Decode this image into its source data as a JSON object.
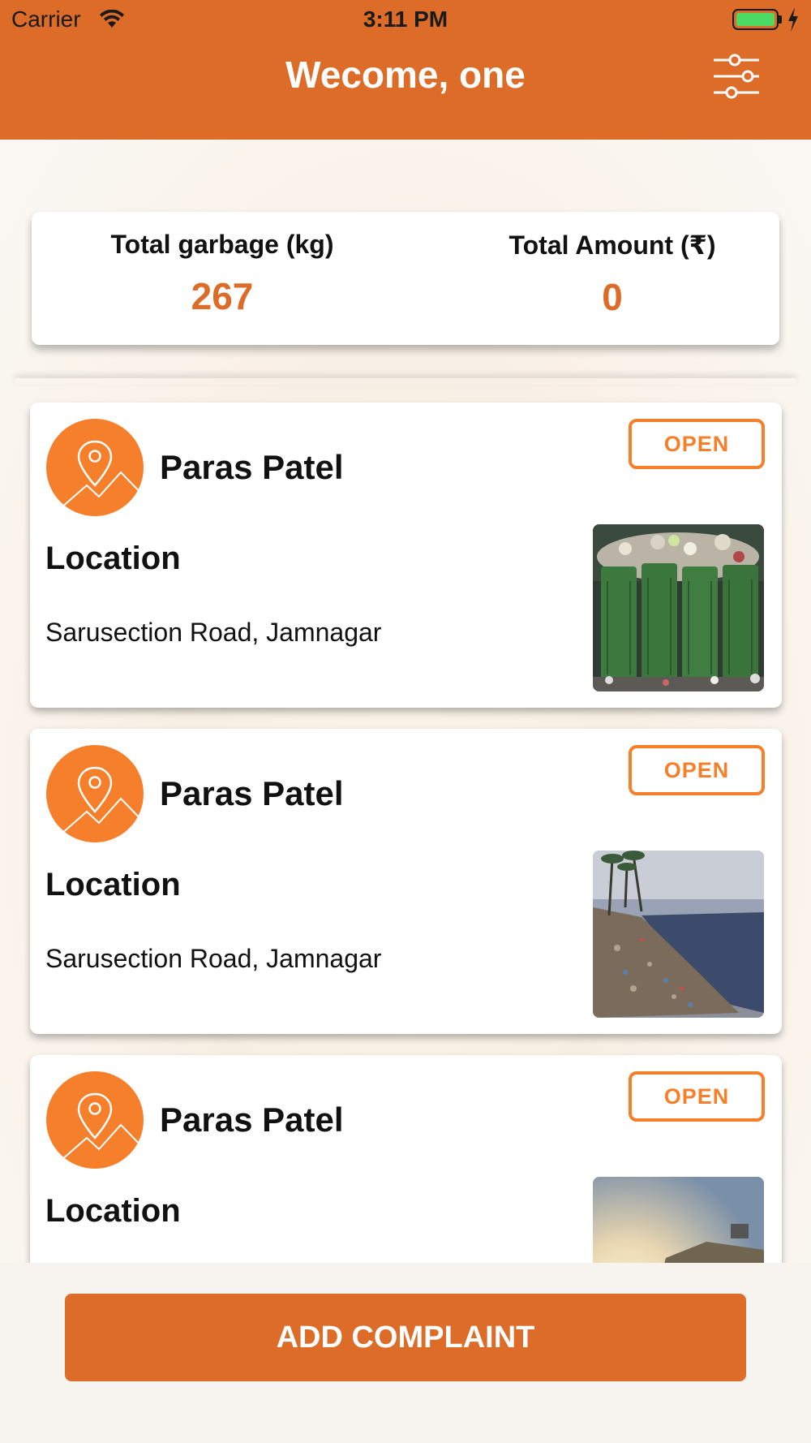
{
  "status_bar": {
    "carrier": "Carrier",
    "time": "3:11 PM",
    "battery_color": "#4cd964"
  },
  "header": {
    "title": "Wecome, one",
    "filter_icon": "sliders-icon",
    "background": "#dc6c28"
  },
  "summary": {
    "garbage_label": "Total garbage (kg)",
    "garbage_value": "267",
    "amount_label": "Total Amount (₹)",
    "amount_value": "0"
  },
  "complaints": [
    {
      "name": "Paras Patel",
      "status": "OPEN",
      "location_title": "Location",
      "location": "Sarusection Road, Jamnagar",
      "image": "garbage-bins"
    },
    {
      "name": "Paras Patel",
      "status": "OPEN",
      "location_title": "Location",
      "location": "Sarusection Road, Jamnagar",
      "image": "polluted-beach"
    },
    {
      "name": "Paras Patel",
      "status": "OPEN",
      "location_title": "Location",
      "location": "",
      "image": "landfill-sunset"
    }
  ],
  "footer": {
    "add_button": "ADD COMPLAINT"
  },
  "colors": {
    "accent": "#dc6c28",
    "badge": "#f57f2a"
  }
}
